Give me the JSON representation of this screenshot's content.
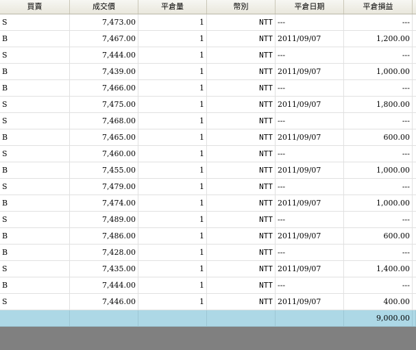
{
  "columns": [
    "買賣",
    "成交價",
    "平倉量",
    "幣別",
    "平倉日期",
    "平倉損益"
  ],
  "rows": [
    {
      "side": "S",
      "price": "7,473.00",
      "qty": "1",
      "currency": "NTT",
      "date": "---",
      "pnl": "---"
    },
    {
      "side": "B",
      "price": "7,467.00",
      "qty": "1",
      "currency": "NTT",
      "date": "2011/09/07",
      "pnl": "1,200.00"
    },
    {
      "side": "S",
      "price": "7,444.00",
      "qty": "1",
      "currency": "NTT",
      "date": "---",
      "pnl": "---"
    },
    {
      "side": "B",
      "price": "7,439.00",
      "qty": "1",
      "currency": "NTT",
      "date": "2011/09/07",
      "pnl": "1,000.00"
    },
    {
      "side": "B",
      "price": "7,466.00",
      "qty": "1",
      "currency": "NTT",
      "date": "---",
      "pnl": "---"
    },
    {
      "side": "S",
      "price": "7,475.00",
      "qty": "1",
      "currency": "NTT",
      "date": "2011/09/07",
      "pnl": "1,800.00"
    },
    {
      "side": "S",
      "price": "7,468.00",
      "qty": "1",
      "currency": "NTT",
      "date": "---",
      "pnl": "---"
    },
    {
      "side": "B",
      "price": "7,465.00",
      "qty": "1",
      "currency": "NTT",
      "date": "2011/09/07",
      "pnl": "600.00"
    },
    {
      "side": "S",
      "price": "7,460.00",
      "qty": "1",
      "currency": "NTT",
      "date": "---",
      "pnl": "---"
    },
    {
      "side": "B",
      "price": "7,455.00",
      "qty": "1",
      "currency": "NTT",
      "date": "2011/09/07",
      "pnl": "1,000.00"
    },
    {
      "side": "S",
      "price": "7,479.00",
      "qty": "1",
      "currency": "NTT",
      "date": "---",
      "pnl": "---"
    },
    {
      "side": "B",
      "price": "7,474.00",
      "qty": "1",
      "currency": "NTT",
      "date": "2011/09/07",
      "pnl": "1,000.00"
    },
    {
      "side": "S",
      "price": "7,489.00",
      "qty": "1",
      "currency": "NTT",
      "date": "---",
      "pnl": "---"
    },
    {
      "side": "B",
      "price": "7,486.00",
      "qty": "1",
      "currency": "NTT",
      "date": "2011/09/07",
      "pnl": "600.00"
    },
    {
      "side": "B",
      "price": "7,428.00",
      "qty": "1",
      "currency": "NTT",
      "date": "---",
      "pnl": "---"
    },
    {
      "side": "S",
      "price": "7,435.00",
      "qty": "1",
      "currency": "NTT",
      "date": "2011/09/07",
      "pnl": "1,400.00"
    },
    {
      "side": "B",
      "price": "7,444.00",
      "qty": "1",
      "currency": "NTT",
      "date": "---",
      "pnl": "---"
    },
    {
      "side": "S",
      "price": "7,446.00",
      "qty": "1",
      "currency": "NTT",
      "date": "2011/09/07",
      "pnl": "400.00"
    }
  ],
  "total": {
    "pnl": "9,000.00"
  },
  "colors": {
    "total_row": "#add8e6",
    "background": "#808080"
  }
}
